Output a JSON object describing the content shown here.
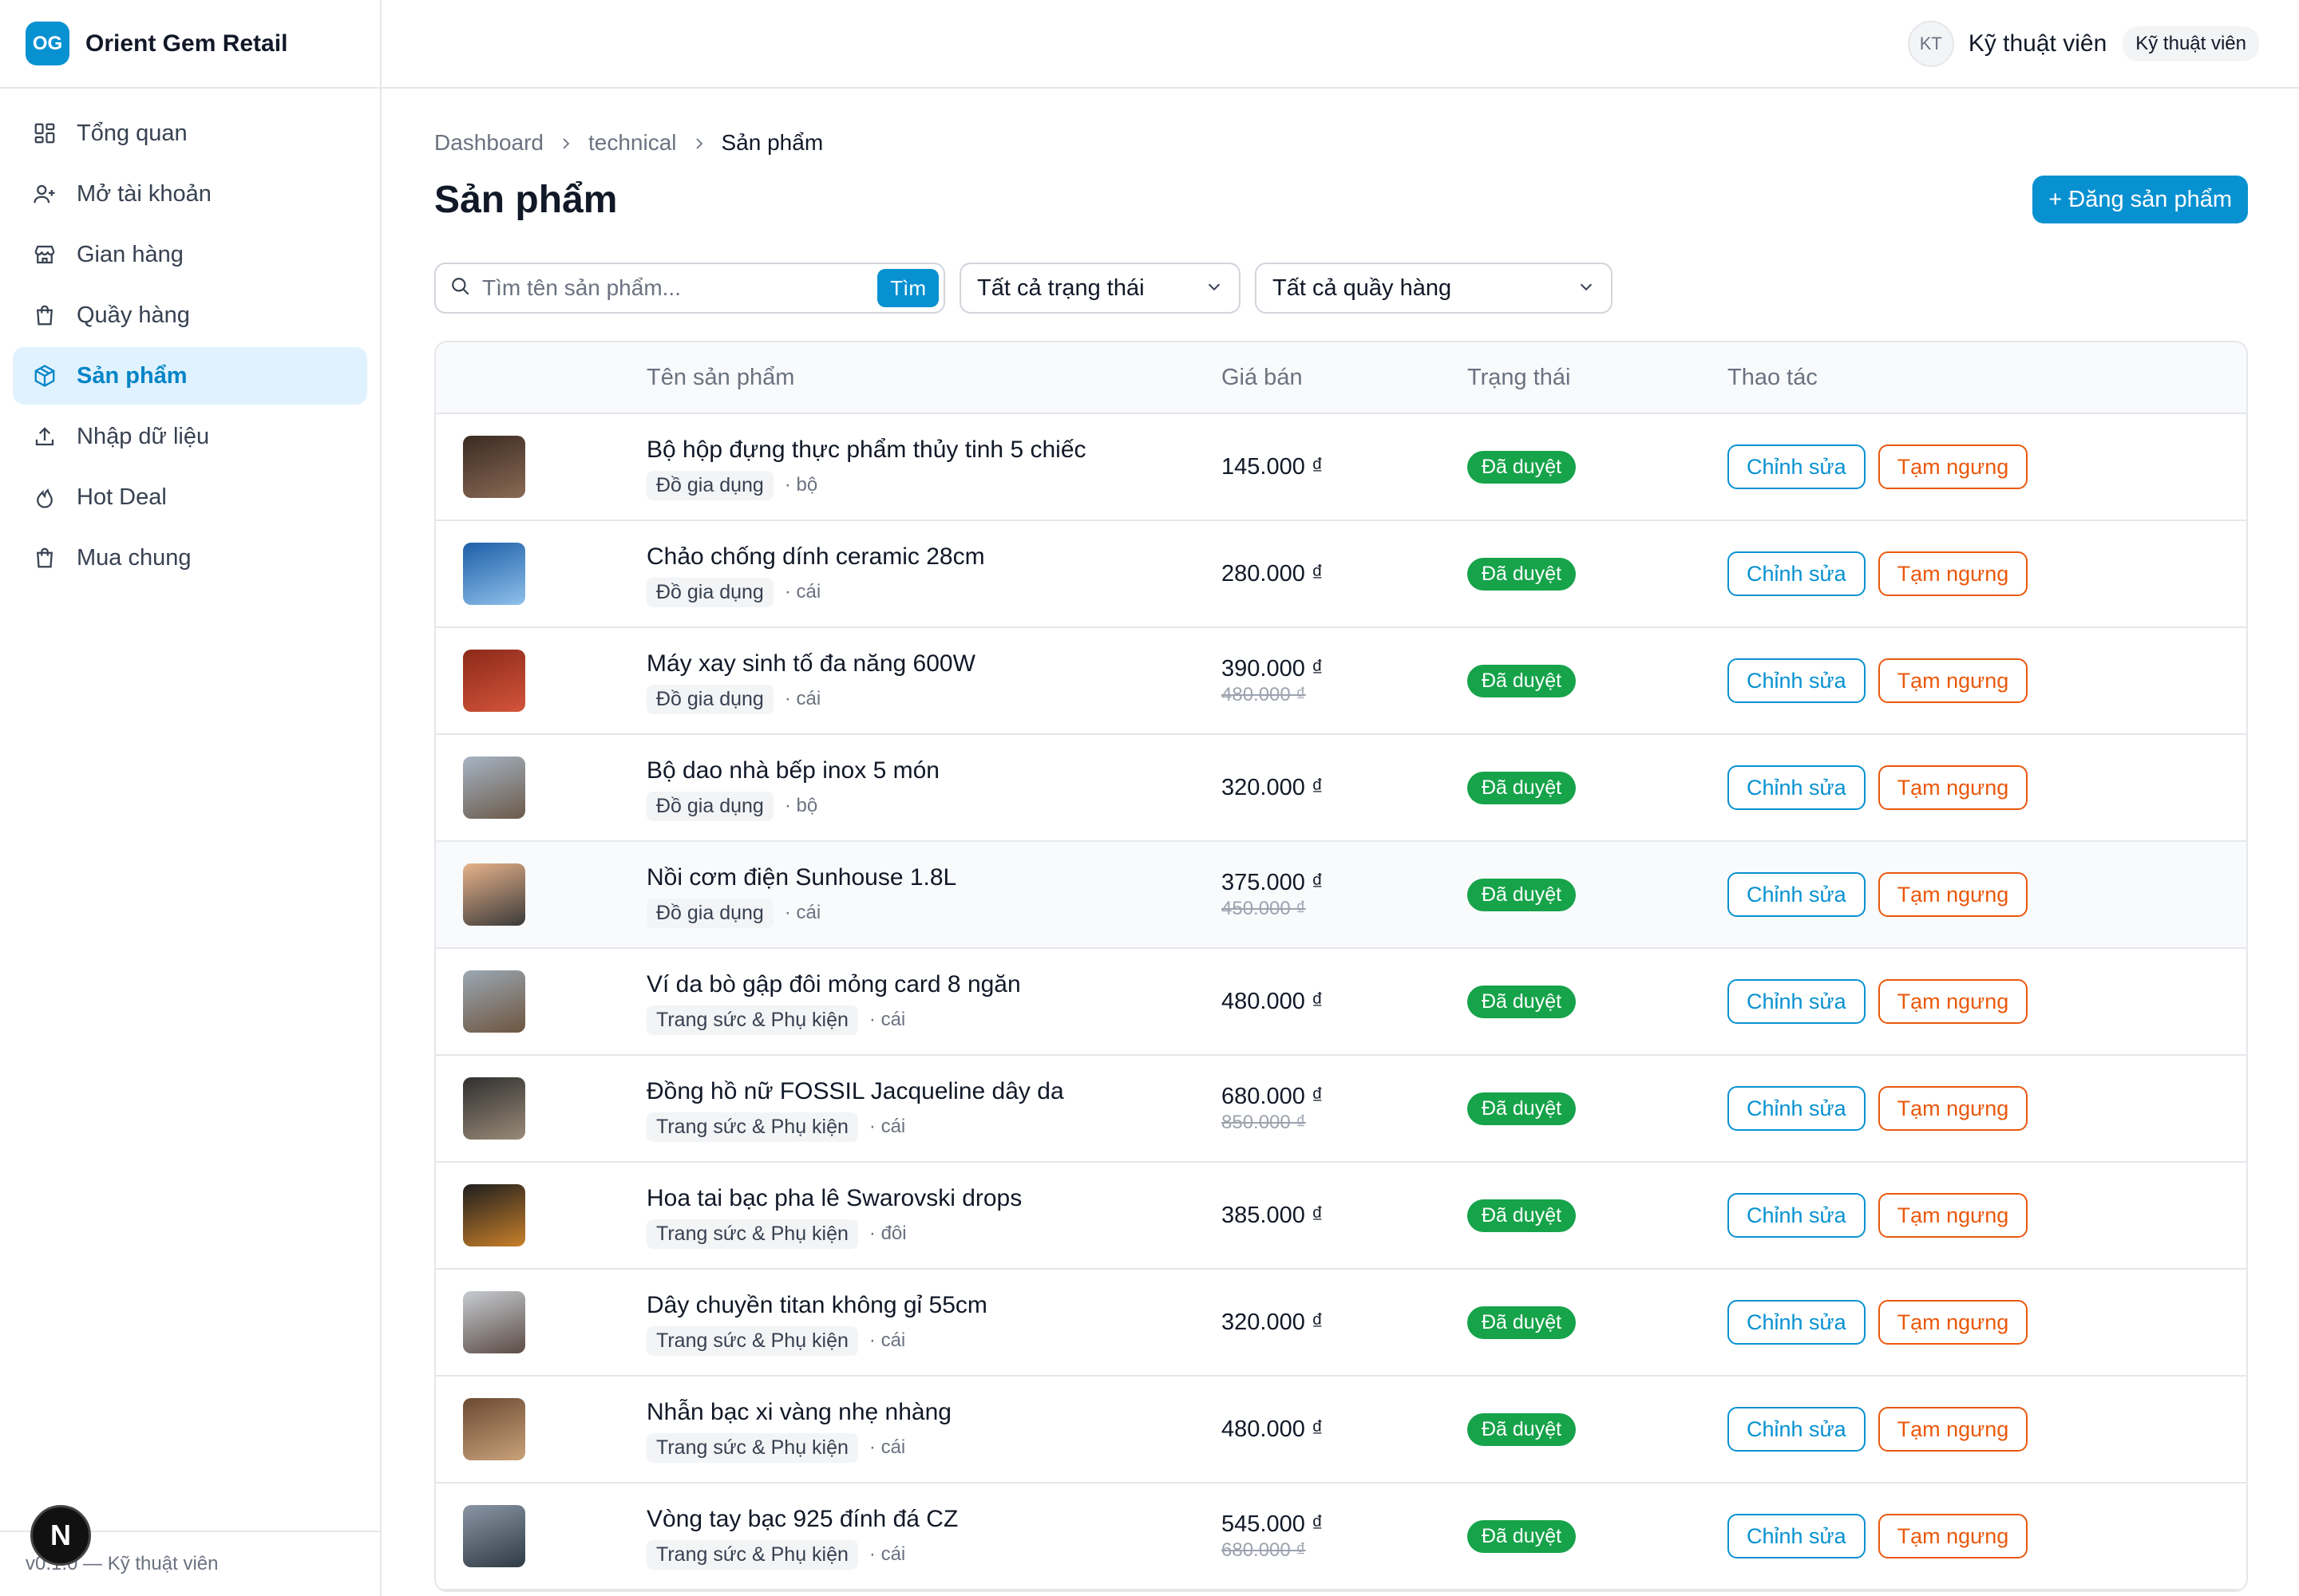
{
  "app": {
    "logo": "OG",
    "name": "Orient Gem Retail",
    "footer": "v0.1.0 — Kỹ thuật viên",
    "dev_badge": "N"
  },
  "user": {
    "initials": "KT",
    "name": "Kỹ thuật viên",
    "role": "Kỹ thuật viên"
  },
  "sidebar": {
    "items": [
      {
        "label": "Tổng quan",
        "icon": "grid-icon",
        "active": false
      },
      {
        "label": "Mở tài khoản",
        "icon": "user-plus-icon",
        "active": false
      },
      {
        "label": "Gian hàng",
        "icon": "store-icon",
        "active": false
      },
      {
        "label": "Quầy hàng",
        "icon": "shopping-bag-icon",
        "active": false
      },
      {
        "label": "Sản phẩm",
        "icon": "box-icon",
        "active": true
      },
      {
        "label": "Nhập dữ liệu",
        "icon": "upload-icon",
        "active": false
      },
      {
        "label": "Hot Deal",
        "icon": "flame-icon",
        "active": false
      },
      {
        "label": "Mua chung",
        "icon": "shopping-bag-icon",
        "active": false
      }
    ]
  },
  "breadcrumb": [
    "Dashboard",
    "technical",
    "Sản phẩm"
  ],
  "page": {
    "title": "Sản phẩm",
    "add_button": "+ Đăng sản phẩm"
  },
  "filters": {
    "search_placeholder": "Tìm tên sản phẩm...",
    "search_button": "Tìm",
    "status_select": "Tất cả trạng thái",
    "booth_select": "Tất cả quầy hàng"
  },
  "table": {
    "headers": [
      "",
      "Tên sản phẩm",
      "Giá bán",
      "Trạng thái",
      "Thao tác"
    ],
    "edit_label": "Chỉnh sửa",
    "pause_label": "Tạm ngưng",
    "rows": [
      {
        "name": "Bộ hộp đựng thực phẩm thủy tinh 5 chiếc",
        "category": "Đồ gia dụng",
        "unit": "· bộ",
        "price": "145.000 ₫",
        "old_price": "",
        "status": "Đã duyệt",
        "thumb": [
          "#3a2a22",
          "#8a6a55"
        ]
      },
      {
        "name": "Chảo chống dính ceramic 28cm",
        "category": "Đồ gia dụng",
        "unit": "· cái",
        "price": "280.000 ₫",
        "old_price": "",
        "status": "Đã duyệt",
        "thumb": [
          "#1d5fa8",
          "#8fc0ea"
        ]
      },
      {
        "name": "Máy xay sinh tố đa năng 600W",
        "category": "Đồ gia dụng",
        "unit": "· cái",
        "price": "390.000 ₫",
        "old_price": "480.000 ₫",
        "status": "Đã duyệt",
        "thumb": [
          "#8c2a1a",
          "#d3543a"
        ]
      },
      {
        "name": "Bộ dao nhà bếp inox 5 món",
        "category": "Đồ gia dụng",
        "unit": "· bộ",
        "price": "320.000 ₫",
        "old_price": "",
        "status": "Đã duyệt",
        "thumb": [
          "#a6b4c4",
          "#6b5a4a"
        ]
      },
      {
        "name": "Nồi cơm điện Sunhouse 1.8L",
        "category": "Đồ gia dụng",
        "unit": "· cái",
        "price": "375.000 ₫",
        "old_price": "450.000 ₫",
        "status": "Đã duyệt",
        "thumb": [
          "#e7b28a",
          "#3b3a3a"
        ]
      },
      {
        "name": "Ví da bò gập đôi mỏng card 8 ngăn",
        "category": "Trang sức & Phụ kiện",
        "unit": "· cái",
        "price": "480.000 ₫",
        "old_price": "",
        "status": "Đã duyệt",
        "thumb": [
          "#9aa8b3",
          "#6e5540"
        ]
      },
      {
        "name": "Đồng hồ nữ FOSSIL Jacqueline dây da",
        "category": "Trang sức & Phụ kiện",
        "unit": "· cái",
        "price": "680.000 ₫",
        "old_price": "850.000 ₫",
        "status": "Đã duyệt",
        "thumb": [
          "#2f2f2f",
          "#9a8a78"
        ]
      },
      {
        "name": "Hoa tai bạc pha lê Swarovski drops",
        "category": "Trang sức & Phụ kiện",
        "unit": "· đôi",
        "price": "385.000 ₫",
        "old_price": "",
        "status": "Đã duyệt",
        "thumb": [
          "#1e1e1e",
          "#c9802a"
        ]
      },
      {
        "name": "Dây chuyền titan không gỉ 55cm",
        "category": "Trang sức & Phụ kiện",
        "unit": "· cái",
        "price": "320.000 ₫",
        "old_price": "",
        "status": "Đã duyệt",
        "thumb": [
          "#c7ccd1",
          "#5b4b45"
        ]
      },
      {
        "name": "Nhẫn bạc xi vàng nhẹ nhàng",
        "category": "Trang sức & Phụ kiện",
        "unit": "· cái",
        "price": "480.000 ₫",
        "old_price": "",
        "status": "Đã duyệt",
        "thumb": [
          "#6b4a32",
          "#c9a27a"
        ]
      },
      {
        "name": "Vòng tay bạc 925 đính đá CZ",
        "category": "Trang sức & Phụ kiện",
        "unit": "· cái",
        "price": "545.000 ₫",
        "old_price": "680.000 ₫",
        "status": "Đã duyệt",
        "thumb": [
          "#8a96a4",
          "#2e3a44"
        ]
      }
    ]
  }
}
